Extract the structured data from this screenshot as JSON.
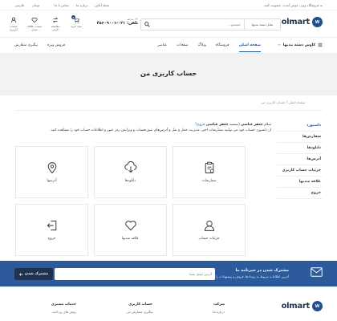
{
  "topbar": {
    "announcement": "به فروشگاه ویژن خوش آمدید. عضویت کنید.",
    "lang": "فارسی",
    "currency": "تومان",
    "contact_label": "تماس با ما",
    "about_label": "درباره ما",
    "blog_label": "مجله آنلاین"
  },
  "header": {
    "logo_text": "olmart",
    "logo_mark": "W",
    "search_placeholder": "جستجو...",
    "search_category": "تمام دسته بندیها",
    "phone_label": "۲۴ ساعته",
    "phone_number": "تلفن: ۰۲۱-۴۵۶۰۹۰۰۱",
    "icons": [
      {
        "label": "سبد خرید",
        "badge": "0"
      },
      {
        "label": "مقایسه کردن"
      },
      {
        "label": "لیست علاقه مندی"
      },
      {
        "label": "حساب کاربری"
      }
    ]
  },
  "nav": {
    "categories_label": "کاوش دسته بندیها",
    "items": [
      "صفحه اصلی",
      "فروشگاه",
      "وبلاگ",
      "صفحات",
      "عناصر"
    ],
    "active_index": 0,
    "track_order": "پیگیری سفارش",
    "special_sale": "فروش ویژه"
  },
  "page": {
    "title": "حساب کاربری من",
    "breadcrumb": "صفحه اصلی / حساب کاربری من"
  },
  "sidebar": {
    "items": [
      "داشبورد",
      "سفارش‌ها",
      "دانلودها",
      "آدرس‌ها",
      "جزئیات حساب کاربری",
      "علاقه مندیها",
      "خروج"
    ],
    "active_index": 0
  },
  "welcome": {
    "line1_prefix": "سلام",
    "user_name": "جعفر عباسی",
    "line1_mid": "(نیستید",
    "user_name2": "جعفر عباسی",
    "logout_link": "خروج؟",
    "line2": "از داشبورد حساب خود می توانید سفارشات اخیر، مدیریت حمل و نقل و آدرس‌های صورتحساب و ویرایش رمز عبور و اطلاعات حساب خود را مشاهده کنید."
  },
  "cards": [
    {
      "label": "سفارشات",
      "icon": "clipboard-icon"
    },
    {
      "label": "دانلودها",
      "icon": "download-icon"
    },
    {
      "label": "آدرسها",
      "icon": "location-icon"
    },
    {
      "label": "جزئیات حساب",
      "icon": "user-icon"
    },
    {
      "label": "علاقه مندیها",
      "icon": "heart-icon"
    },
    {
      "label": "خروج",
      "icon": "logout-icon"
    }
  ],
  "newsletter": {
    "title": "مشترک شدن در خبرنامه ما",
    "subtitle": "آخرین اطلاعات مربوط به رویدادها، فروش و پیشنهادات را دریافت کنید.",
    "placeholder": "آدرس ایمیل شما",
    "button": "مشترک شدن"
  },
  "footer": {
    "col1_title": "شرکت",
    "col1_item": "درباره ما",
    "col2_title": "حساب کاربری",
    "col2_item": "پیگیری سفارش من",
    "col3_title": "خدمات مشتری",
    "col3_item": "روش های پرداخت",
    "logo_text": "olmart"
  },
  "colors": {
    "brand": "#1f4f8f",
    "newsletter_bg": "#2d5a9a",
    "dark": "#1f3350"
  }
}
